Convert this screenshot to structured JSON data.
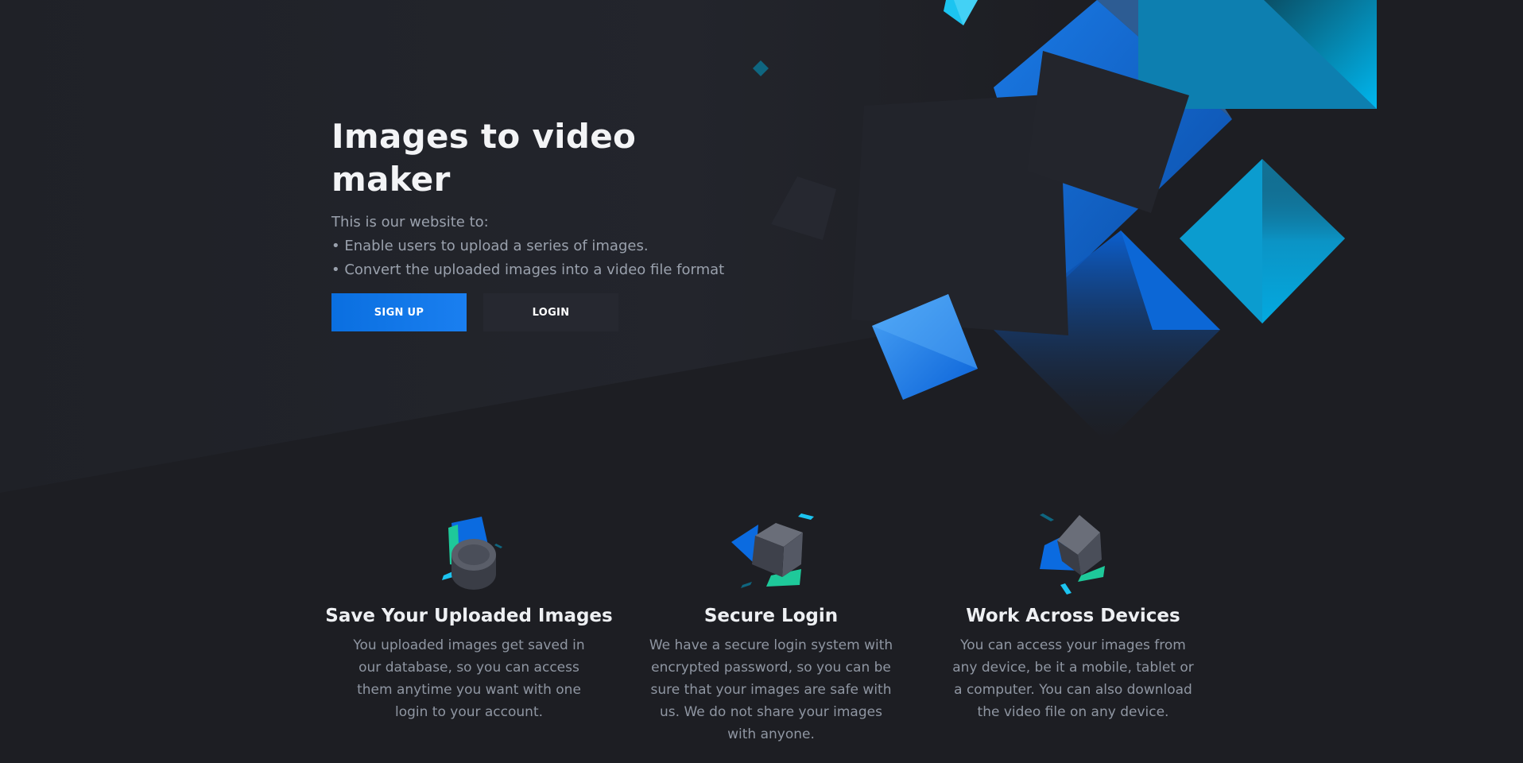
{
  "hero": {
    "title": "Images to video maker",
    "description_lines": [
      "This is our website to:",
      "• Enable users to upload a series of images.",
      "• Convert the uploaded images into a video file format"
    ],
    "signup_label": "SIGN UP",
    "login_label": "LOGIN"
  },
  "features": [
    {
      "title": "Save Your Uploaded Images",
      "text": "You uploaded images get saved in our database, so you can access them anytime you want with one login to your account.",
      "icon": "cylinder-icon"
    },
    {
      "title": "Secure Login",
      "text": "We have a secure login system with encrypted password, so you can be sure that your images are safe with us. We do not share your images with anyone.",
      "icon": "cube-icon"
    },
    {
      "title": "Work Across Devices",
      "text": "You can access your images from any device, be it a mobile, tablet or a computer. You can also download the video file on any device.",
      "icon": "devices-cube-icon"
    }
  ],
  "colors": {
    "background": "#1d1e23",
    "accent_blue": "#0a6fe0",
    "accent_cyan": "#1cc4f0",
    "accent_green": "#1ec99a"
  }
}
